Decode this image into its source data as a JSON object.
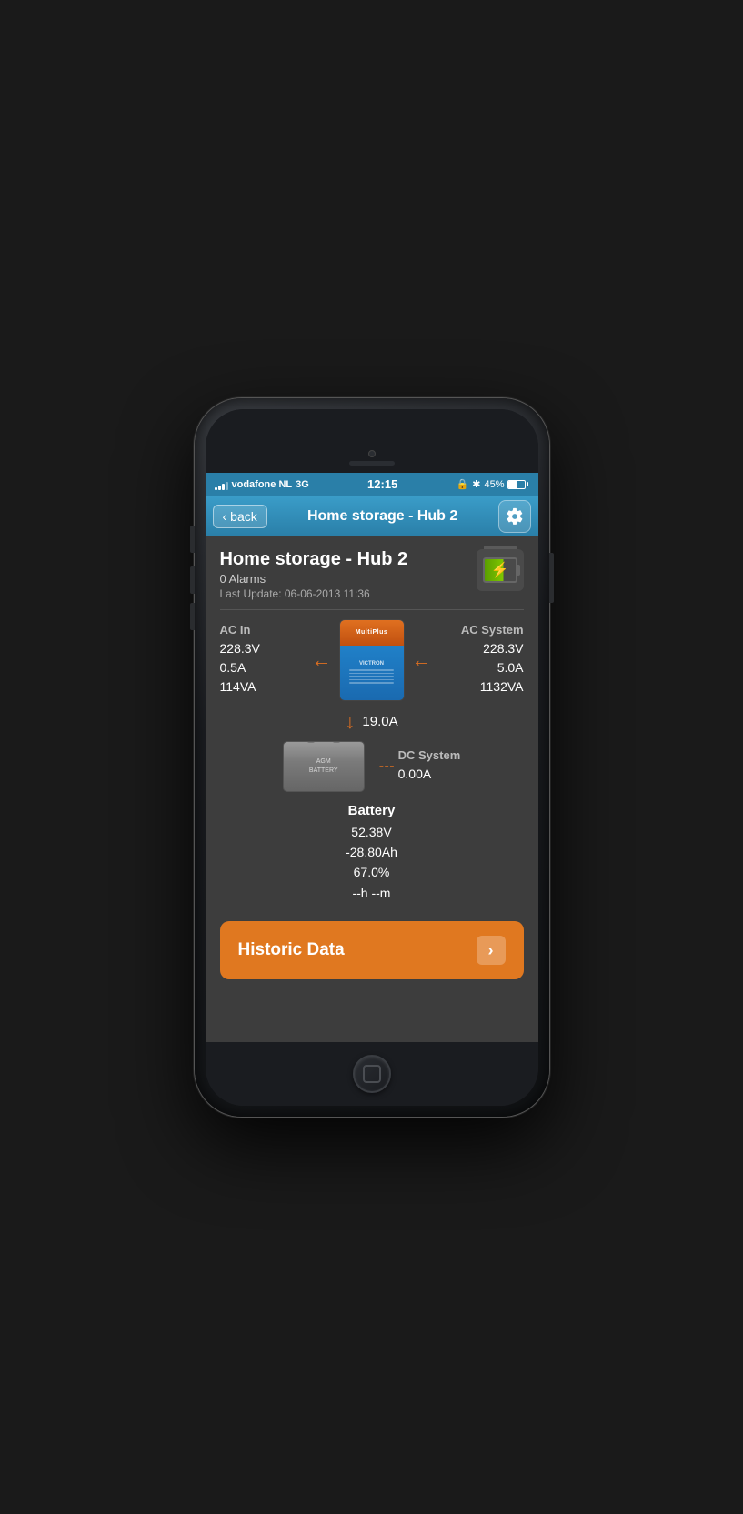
{
  "phone": {
    "status_bar": {
      "carrier": "vodafone NL",
      "network": "3G",
      "time": "12:15",
      "battery_percent": "45%"
    },
    "nav": {
      "back_label": "back",
      "title": "Home storage - Hub 2"
    },
    "page": {
      "heading": "Home storage - Hub 2",
      "alarms": "0 Alarms",
      "last_update": "Last Update: 06-06-2013 11:36",
      "ac_in": {
        "label": "AC In",
        "voltage": "228.3V",
        "current": "0.5A",
        "power": "114VA"
      },
      "ac_system": {
        "label": "AC System",
        "voltage": "228.3V",
        "current": "5.0A",
        "power": "1132VA"
      },
      "dc_current_label": "19.0A",
      "dc_system": {
        "label": "DC System",
        "current": "0.00A"
      },
      "battery": {
        "label": "Battery",
        "voltage": "52.38V",
        "ah": "-28.80Ah",
        "percent": "67.0%",
        "time": "--h --m"
      },
      "historic_data_btn": "Historic Data"
    }
  }
}
